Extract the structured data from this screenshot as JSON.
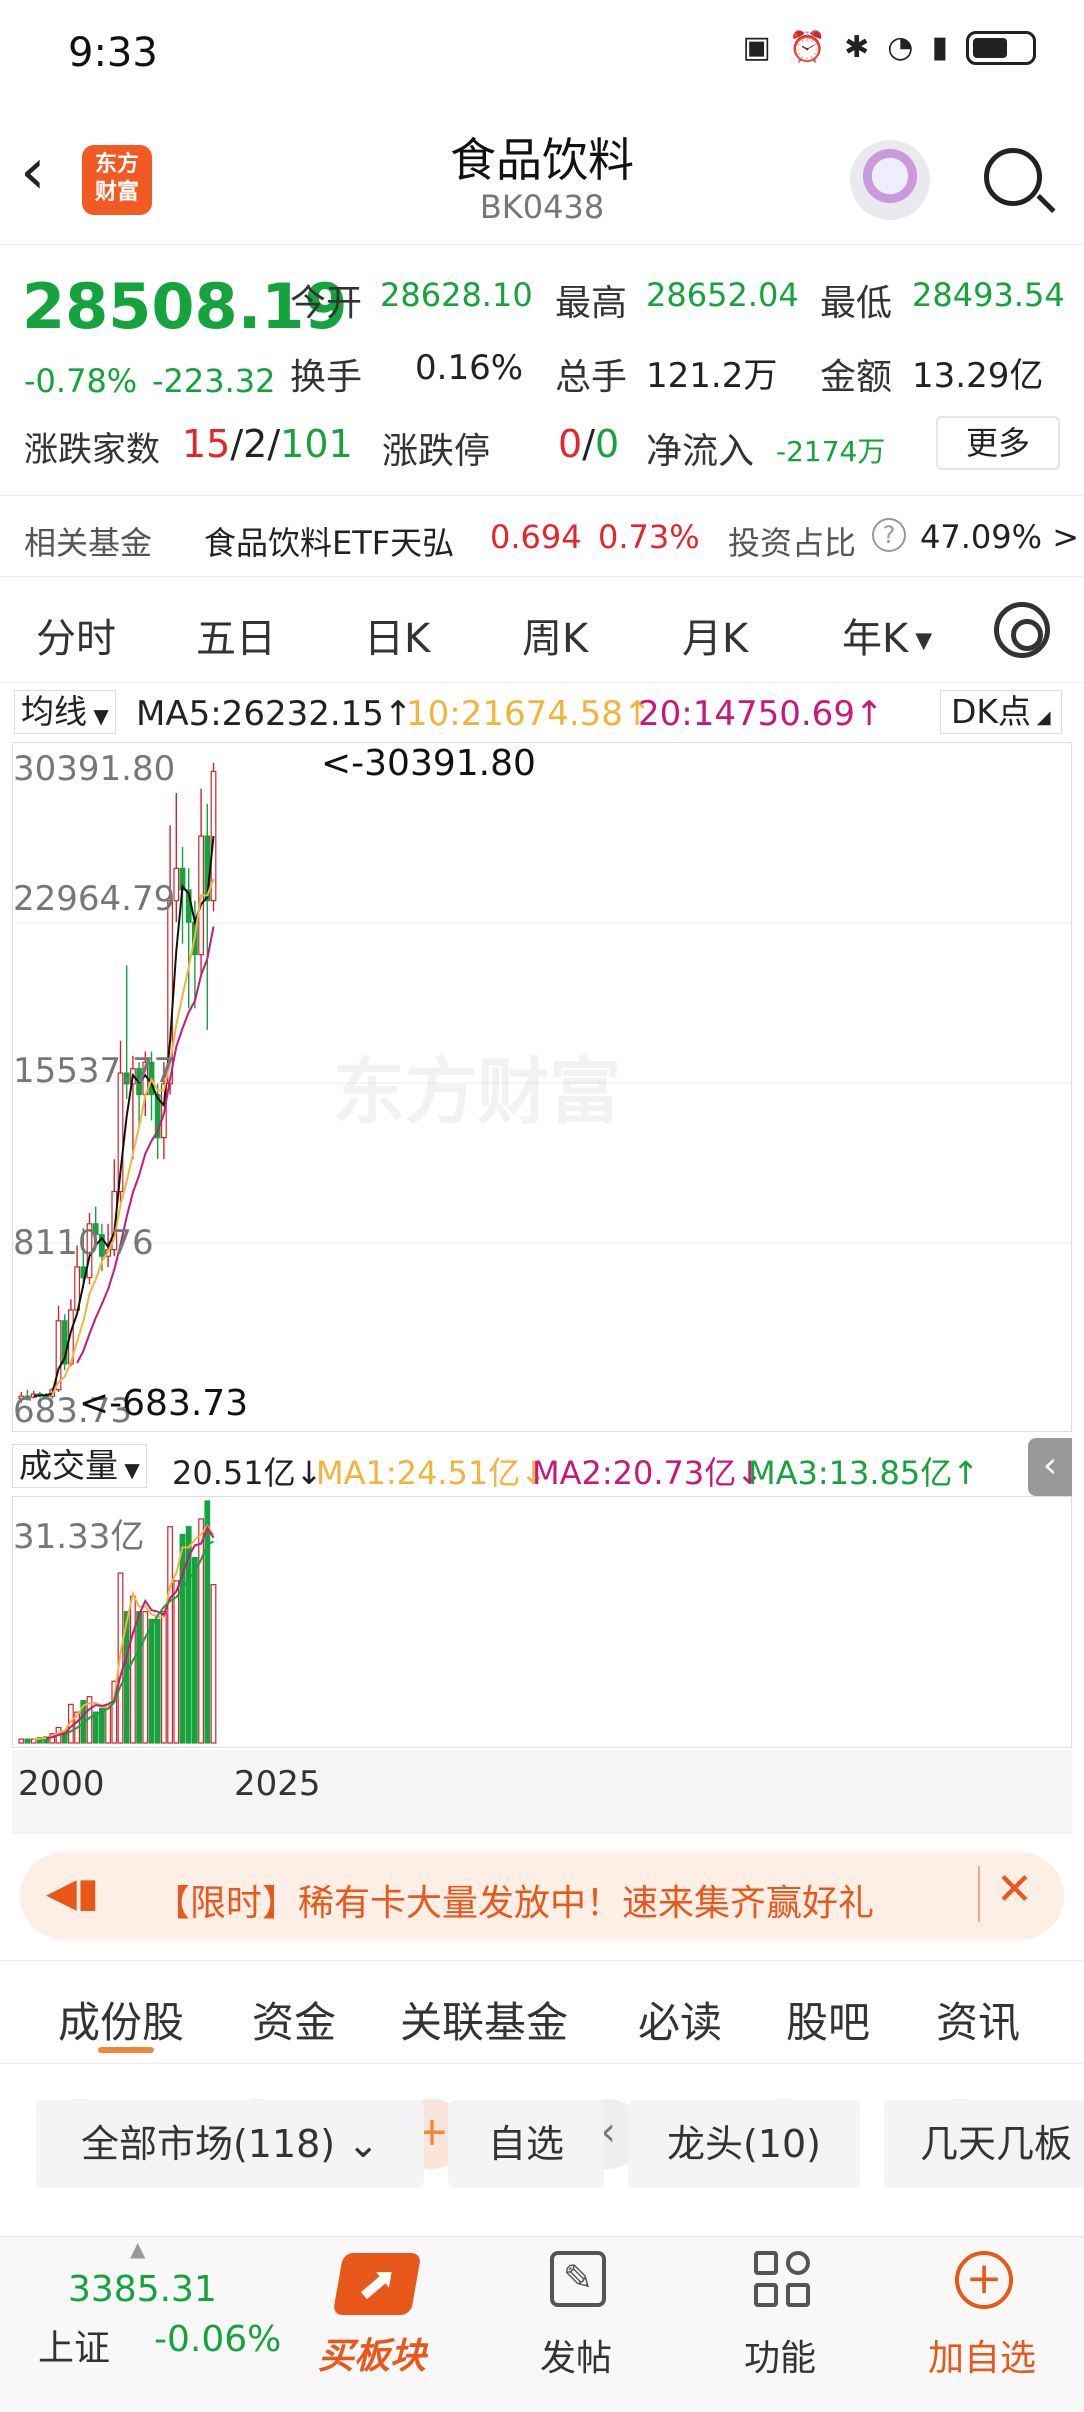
{
  "status": {
    "time": "9:33"
  },
  "header": {
    "logo": "东方\n财富",
    "title": "食品饮料",
    "code": "BK0438"
  },
  "quote": {
    "price": "28508.19",
    "change_pct": "-0.78%",
    "change": "-223.32",
    "open_label": "今开",
    "open": "28628.10",
    "high_label": "最高",
    "high": "28652.04",
    "low_label": "最低",
    "low": "28493.54",
    "turnover_label": "换手",
    "turnover": "0.16%",
    "volume_label": "总手",
    "volume": "121.2万",
    "amount_label": "金额",
    "amount": "13.29亿",
    "updown_label": "涨跌家数",
    "up": "15",
    "flat": "2",
    "down": "101",
    "limit_label": "涨跌停",
    "limit_up": "0",
    "limit_down": "0",
    "inflow_label": "净流入",
    "inflow": "-2174万",
    "more": "更多"
  },
  "fund": {
    "label": "相关基金",
    "name": "食品饮料ETF天弘",
    "price": "0.694",
    "pct": "0.73%",
    "ratio_label": "投资占比",
    "ratio": "47.09% >"
  },
  "period_tabs": [
    "分时",
    "五日",
    "日K",
    "周K",
    "月K",
    "年K"
  ],
  "ma_row": {
    "selector": "均线",
    "ma5": "MA5:26232.15↑",
    "ma10": "10:21674.58↑",
    "ma20": "20:14750.69↑",
    "dk": "DK点"
  },
  "chart_data": {
    "type": "candlestick",
    "y_ticks": [
      "30391.80",
      "22964.79",
      "15537.77",
      "8110.76",
      "683.73"
    ],
    "max_marker": "<-30391.80",
    "min_marker": "<-683.73",
    "watermark": "东方财富",
    "x_labels": [
      "2000",
      "2025"
    ],
    "ylim": [
      683.73,
      30391.8
    ],
    "candles": [
      [
        900,
        1000,
        700,
        1200
      ],
      [
        1000,
        950,
        800,
        1300
      ],
      [
        950,
        1100,
        900,
        1250
      ],
      [
        1100,
        1050,
        950,
        1200
      ],
      [
        1050,
        1000,
        850,
        1150
      ],
      [
        1000,
        1300,
        900,
        1400
      ],
      [
        1300,
        4500,
        1200,
        5200
      ],
      [
        4500,
        2500,
        2200,
        4800
      ],
      [
        2500,
        5000,
        2400,
        5500
      ],
      [
        5000,
        7000,
        4800,
        8000
      ],
      [
        7000,
        6500,
        6000,
        8800
      ],
      [
        6500,
        9000,
        6200,
        9500
      ],
      [
        9000,
        8500,
        8000,
        9800
      ],
      [
        8500,
        7500,
        6800,
        9000
      ],
      [
        7500,
        7800,
        7000,
        9000
      ],
      [
        7800,
        10500,
        7500,
        12000
      ],
      [
        10500,
        16000,
        10000,
        17500
      ],
      [
        16000,
        15500,
        14800,
        21000
      ],
      [
        15500,
        16200,
        12000,
        16800
      ],
      [
        16200,
        15000,
        13500,
        16500
      ],
      [
        15000,
        16500,
        14000,
        17000
      ],
      [
        16500,
        15000,
        13800,
        17000
      ],
      [
        15000,
        13000,
        12000,
        15500
      ],
      [
        13000,
        15500,
        12000,
        16500
      ],
      [
        15500,
        24000,
        15000,
        27500
      ],
      [
        24000,
        25500,
        23000,
        29000
      ],
      [
        25500,
        24500,
        22000,
        26500
      ],
      [
        24500,
        23000,
        19000,
        25500
      ],
      [
        23000,
        21500,
        19000,
        24000
      ],
      [
        21500,
        27000,
        20500,
        29200
      ],
      [
        27000,
        24000,
        18000,
        28500
      ],
      [
        24000,
        30000,
        23500,
        30391
      ]
    ],
    "ma_series": [
      {
        "name": "MA5",
        "color": "#111111"
      },
      {
        "name": "MA10",
        "color": "#f2b43c"
      },
      {
        "name": "MA20",
        "color": "#c8187a"
      }
    ]
  },
  "volume": {
    "selector": "成交量",
    "value": "20.51亿↓",
    "ma1": "MA1:24.51亿↓",
    "ma2": "MA2:20.73亿↓",
    "ma3": "MA3:13.85亿↑",
    "y_max": "31.33亿",
    "bars": [
      0.5,
      0.5,
      0.5,
      0.7,
      0.8,
      1.2,
      2,
      1.5,
      5,
      4,
      5.5,
      6,
      4,
      4.5,
      5,
      8,
      22,
      17,
      19,
      17,
      17,
      16,
      16,
      17,
      28,
      21,
      27,
      28,
      24,
      29,
      31.33,
      20.51
    ]
  },
  "banner": {
    "text": "【限时】稀有卡大量发放中！速来集齐赢好礼"
  },
  "bottom_tabs": [
    "成份股",
    "资金",
    "关联基金",
    "必读",
    "股吧",
    "资讯"
  ],
  "filters": [
    "全部市场(118)",
    "自选",
    "龙头(10)",
    "几天几板"
  ],
  "nav": {
    "index_value": "3385.31",
    "index_name": "上证",
    "index_pct": "-0.06%",
    "buy": "买板块",
    "post": "发帖",
    "func": "功能",
    "add": "加自选"
  }
}
